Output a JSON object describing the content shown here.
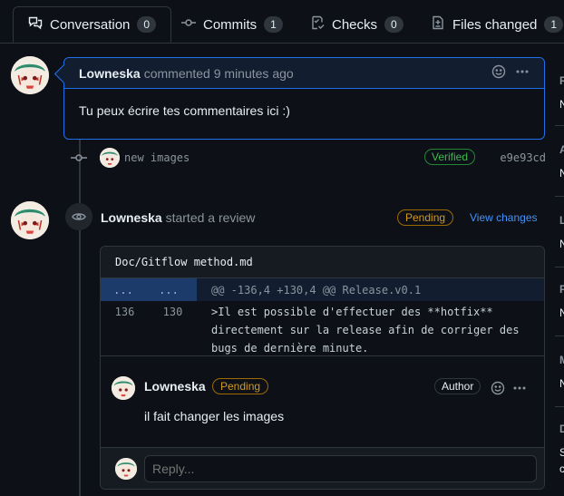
{
  "tabs": [
    {
      "label": "Conversation",
      "count": "0",
      "icon": "comment-discussion-icon"
    },
    {
      "label": "Commits",
      "count": "1",
      "icon": "commit-icon"
    },
    {
      "label": "Checks",
      "count": "0",
      "icon": "checklist-icon"
    },
    {
      "label": "Files changed",
      "count": "1",
      "icon": "file-diff-icon"
    }
  ],
  "comment": {
    "author": "Lowneska",
    "meta": "commented 9 minutes ago",
    "body": "Tu peux écrire tes commentaires ici :)"
  },
  "commit": {
    "message": "new images",
    "badge": "Verified",
    "sha": "e9e93cd"
  },
  "review": {
    "author": "Lowneska",
    "action": "started a review",
    "status": "Pending",
    "view_link": "View changes",
    "file": "Doc/Gitflow method.md",
    "hunk_left": "...",
    "hunk_right": "...",
    "hunk_header": "@@ -136,4 +130,4 @@ Release.v0.1",
    "line_old": "136",
    "line_new": "130",
    "code_lines": [
      ">Il est possible d'effectuer des **hotfix**",
      "directement sur la release afin de corriger des",
      "bugs de dernière minute."
    ],
    "thread": {
      "author": "Lowneska",
      "status": "Pending",
      "role": "Author",
      "body": "il fait changer les images"
    },
    "reply_placeholder": "Reply..."
  },
  "sidebar": {
    "letters": [
      "R",
      "N",
      "A",
      "N",
      "L",
      "N",
      "P",
      "N",
      "M",
      "N",
      "D",
      "S",
      "c"
    ]
  },
  "colors": {
    "accent": "#1f6feb",
    "verified": "#3fb950",
    "pending": "#d29922",
    "link": "#4493f8"
  }
}
